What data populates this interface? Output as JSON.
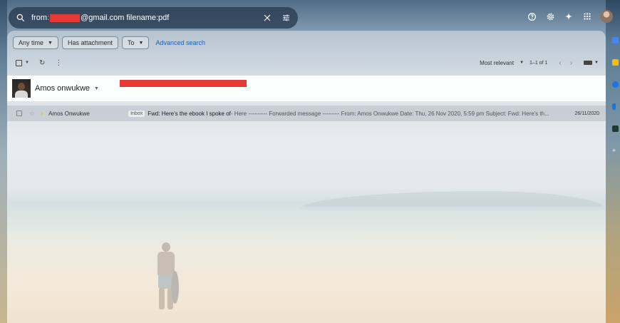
{
  "search": {
    "prefix": "from:",
    "suffix": "@gmail.com filename:pdf"
  },
  "filters": {
    "any_time": "Any time",
    "has_attachment": "Has attachment",
    "to": "To",
    "advanced_search": "Advanced search"
  },
  "toolbar": {
    "sort": "Most relevant",
    "pagination": "1–1 of 1"
  },
  "contact": {
    "name": "Amos onwukwe"
  },
  "emails": [
    {
      "sender": "Amos Onwukwe",
      "label": "Inbox",
      "subject": "Fwd: Here's the ebook I spoke of",
      "snippet": " - Here ---------- Forwarded message --------- From: Amos Onwukwe Date: Thu, 26 Nov 2020, 5:59 pm Subject: Fwd: Here's th...",
      "date": "26/11/2020"
    }
  ],
  "colors": {
    "redaction": "#e53935",
    "link": "#1a5fb4",
    "important": "#f2b400"
  }
}
